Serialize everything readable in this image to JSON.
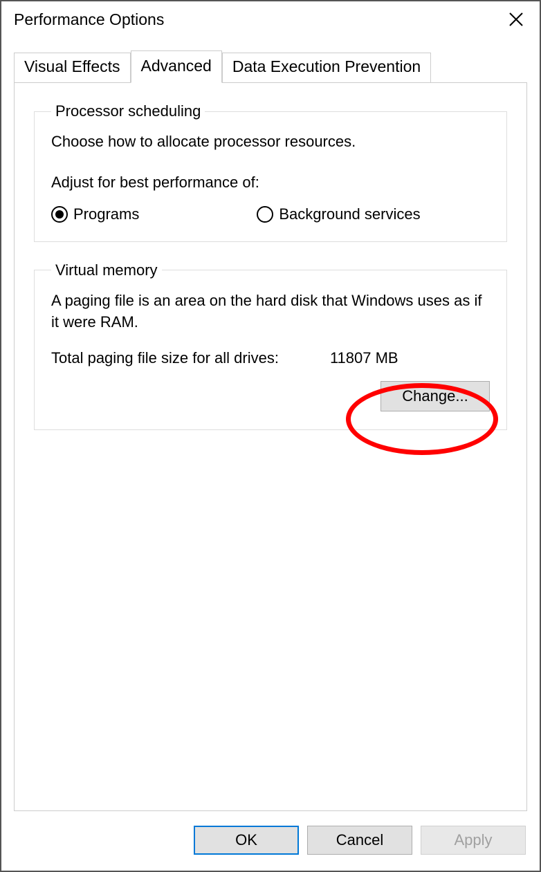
{
  "window": {
    "title": "Performance Options"
  },
  "tabs": {
    "visual_effects": "Visual Effects",
    "advanced": "Advanced",
    "dep": "Data Execution Prevention"
  },
  "processor_scheduling": {
    "legend": "Processor scheduling",
    "desc": "Choose how to allocate processor resources.",
    "subhead": "Adjust for best performance of:",
    "programs": "Programs",
    "background": "Background services"
  },
  "virtual_memory": {
    "legend": "Virtual memory",
    "desc": "A paging file is an area on the hard disk that Windows uses as if it were RAM.",
    "total_label": "Total paging file size for all drives:",
    "total_value": "11807 MB",
    "change_btn": "Change..."
  },
  "buttons": {
    "ok": "OK",
    "cancel": "Cancel",
    "apply": "Apply"
  }
}
